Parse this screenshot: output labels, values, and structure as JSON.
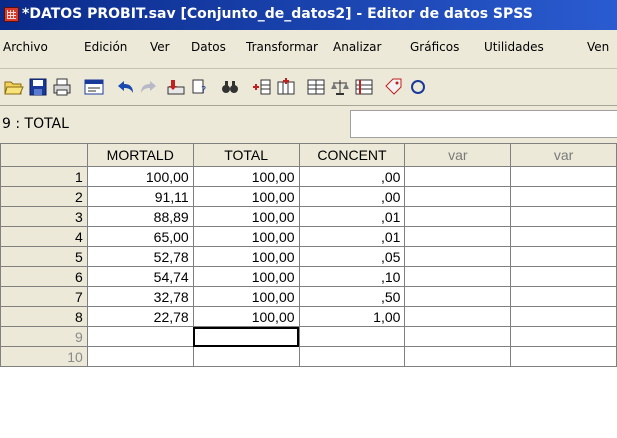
{
  "window": {
    "title": "*DATOS PROBIT.sav [Conjunto_de_datos2] - Editor de datos SPSS"
  },
  "menu": [
    "Archivo",
    "Edición",
    "Ver",
    "Datos",
    "Transformar",
    "Analizar",
    "Gráficos",
    "Utilidades",
    "Ven"
  ],
  "toolbar": {
    "icons": [
      "open-folder-icon",
      "save-icon",
      "print-icon",
      "dialog-recall-icon",
      "undo-icon",
      "redo-icon",
      "goto-case-icon",
      "variables-icon",
      "find-icon",
      "insert-cases-icon",
      "insert-variable-icon",
      "split-file-icon",
      "weight-cases-icon",
      "select-cases-icon",
      "value-labels-icon",
      "use-sets-icon"
    ]
  },
  "ref_bar": {
    "cell_ref": "9 : TOTAL",
    "value": ""
  },
  "grid": {
    "columns": [
      "MORTALD",
      "TOTAL",
      "CONCENT",
      "var",
      "var"
    ],
    "rows": [
      {
        "n": "1",
        "cells": [
          "100,00",
          "100,00",
          ",00",
          "",
          ""
        ]
      },
      {
        "n": "2",
        "cells": [
          "91,11",
          "100,00",
          ",00",
          "",
          ""
        ]
      },
      {
        "n": "3",
        "cells": [
          "88,89",
          "100,00",
          ",01",
          "",
          ""
        ]
      },
      {
        "n": "4",
        "cells": [
          "65,00",
          "100,00",
          ",01",
          "",
          ""
        ]
      },
      {
        "n": "5",
        "cells": [
          "52,78",
          "100,00",
          ",05",
          "",
          ""
        ]
      },
      {
        "n": "6",
        "cells": [
          "54,74",
          "100,00",
          ",10",
          "",
          ""
        ]
      },
      {
        "n": "7",
        "cells": [
          "32,78",
          "100,00",
          ",50",
          "",
          ""
        ]
      },
      {
        "n": "8",
        "cells": [
          "22,78",
          "100,00",
          "1,00",
          "",
          ""
        ]
      },
      {
        "n": "9",
        "cells": [
          "",
          "",
          "",
          "",
          ""
        ]
      },
      {
        "n": "10",
        "cells": [
          "",
          "",
          "",
          "",
          ""
        ]
      }
    ]
  }
}
